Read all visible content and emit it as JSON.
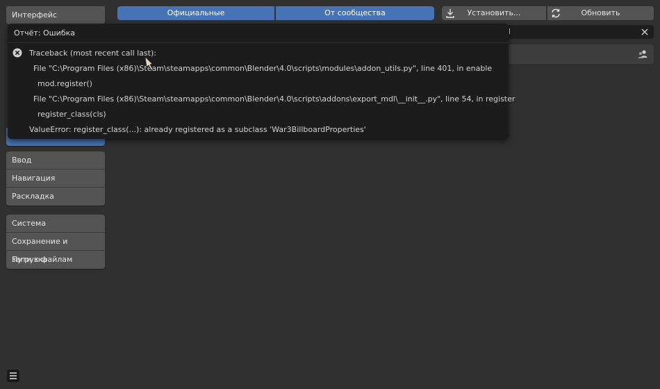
{
  "sidebar": {
    "top_items": [
      "Интерфейс"
    ],
    "group2": [
      "Ввод",
      "Навигация",
      "Раскладка"
    ],
    "group3": [
      "Система",
      "Сохранение и загрузка",
      "Пути к файлам"
    ]
  },
  "toolbar": {
    "tab_official": "Официальные",
    "tab_community": "От сообщества",
    "install_label": "Установить...",
    "refresh_label": "Обновить"
  },
  "search": {
    "value_fragment": "l"
  },
  "report": {
    "title": "Отчёт: Ошибка",
    "lines": [
      "Traceback (most recent call last):",
      "File \"C:\\Program Files (x86)\\Steam\\steamapps\\common\\Blender\\4.0\\scripts\\modules\\addon_utils.py\", line 401, in enable",
      "mod.register()",
      "File \"C:\\Program Files (x86)\\Steam\\steamapps\\common\\Blender\\4.0\\scripts\\addons\\export_mdl\\__init__.py\", line 54, in register",
      "register_class(cls)",
      "ValueError: register_class(...): already registered as a subclass 'War3BillboardProperties'"
    ]
  },
  "colors": {
    "accent": "#4772b3",
    "background": "#303030",
    "popup": "#1c1c1c"
  }
}
